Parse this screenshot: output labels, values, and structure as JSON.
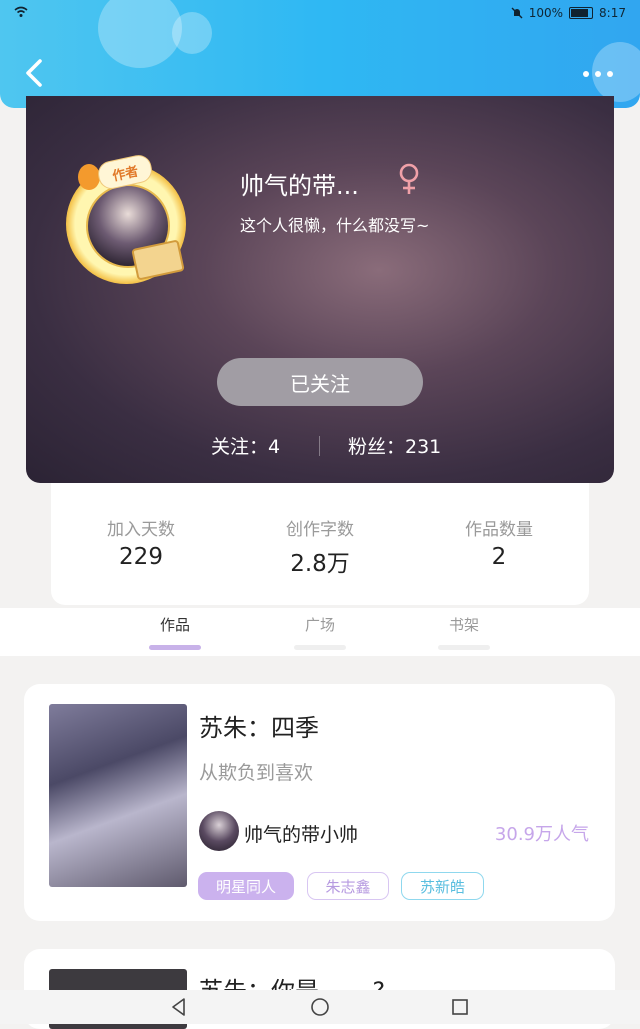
{
  "status_bar": {
    "battery": "100%",
    "time": "8:17"
  },
  "header": {
    "back_icon": "chevron-left-icon",
    "more_icon": "more-dots-icon",
    "accent": "#31b4f2"
  },
  "profile": {
    "badge": "作者",
    "username": "帅气的带...",
    "gender_icon": "female-icon",
    "bio": "这个人很懒，什么都没写~",
    "follow_button": "已关注",
    "following_text": "关注：4",
    "fans_text": "粉丝：231"
  },
  "stats": [
    {
      "label": "加入天数",
      "value": "229"
    },
    {
      "label": "创作字数",
      "value": "2.8万"
    },
    {
      "label": "作品数量",
      "value": "2"
    }
  ],
  "tabs": [
    {
      "label": "作品",
      "active": true
    },
    {
      "label": "广场",
      "active": false
    },
    {
      "label": "书架",
      "active": false
    }
  ],
  "works": [
    {
      "title": "苏朱：四季",
      "subtitle": "从欺负到喜欢",
      "author": "帅气的带小帅",
      "popularity": "30.9万人气",
      "tags": [
        "明星同人",
        "朱志鑫",
        "苏新皓"
      ]
    },
    {
      "title": "苏朱：你是...... ?"
    }
  ],
  "colors": {
    "tag_primary": "#cbb2ee",
    "popularity": "#c6a6ea",
    "tag_cyan": "#59bedf"
  }
}
